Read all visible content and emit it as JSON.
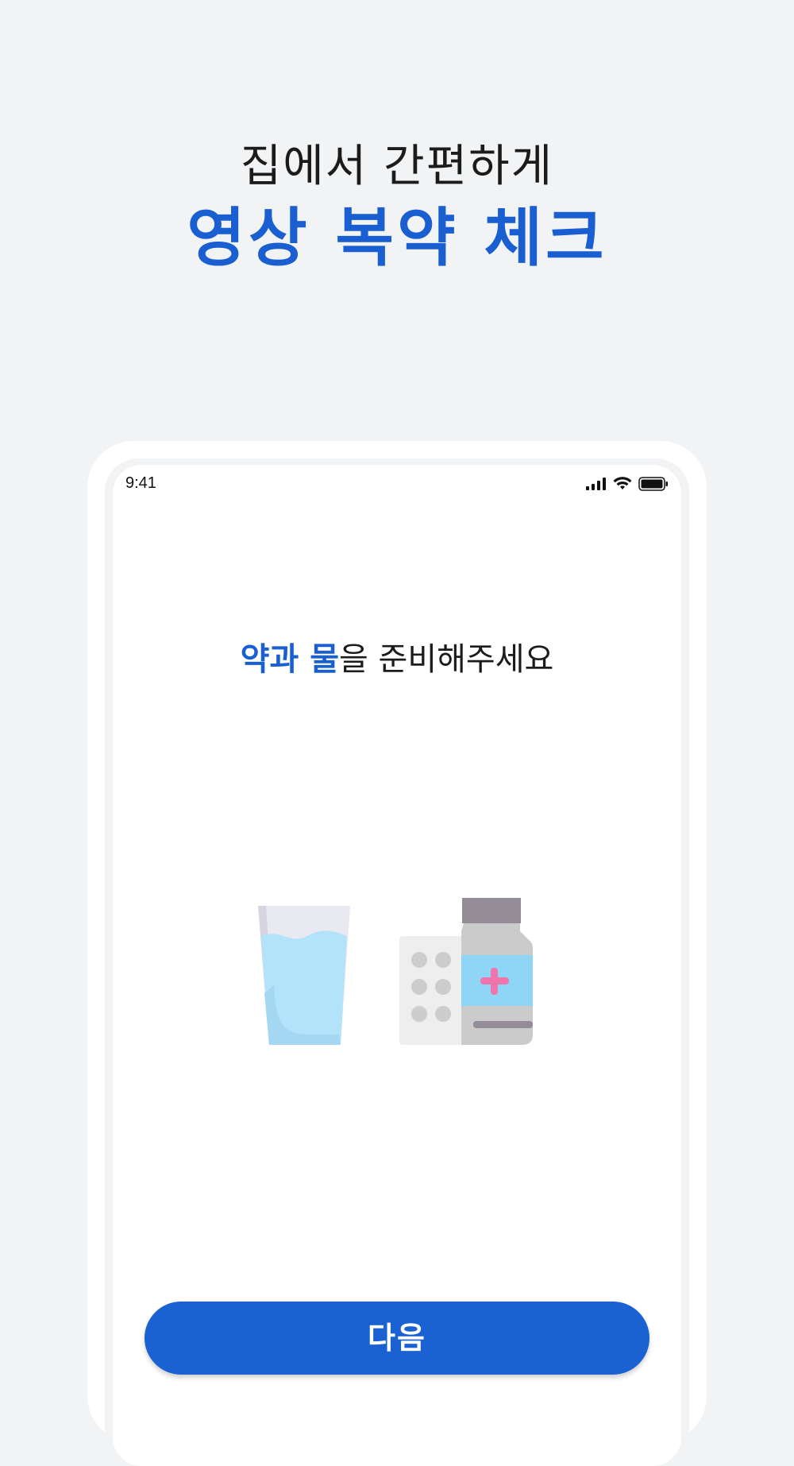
{
  "header": {
    "subtitle": "집에서 간편하게",
    "title": "영상 복약 체크"
  },
  "status_bar": {
    "time": "9:41",
    "icons": [
      "signal-icon",
      "wifi-icon",
      "battery-icon"
    ]
  },
  "screen": {
    "prompt_highlight": "약과 물",
    "prompt_rest": "을 준비해주세요",
    "illustration_icons": [
      "water-glass-icon",
      "pill-blister-icon",
      "medicine-bottle-icon"
    ]
  },
  "actions": {
    "next_label": "다음"
  },
  "colors": {
    "accent": "#1a5fd1",
    "background": "#f2f3f5",
    "text": "#1b1b1b"
  }
}
